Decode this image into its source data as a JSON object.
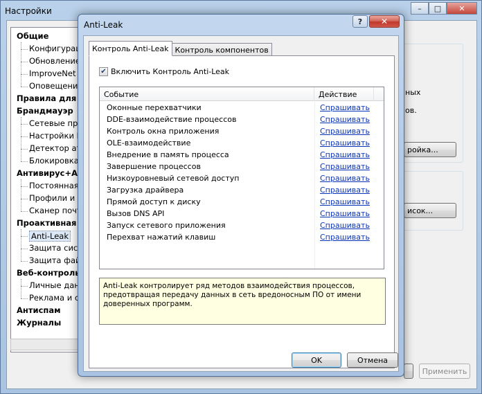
{
  "background_window": {
    "title": "Настройки",
    "controls": {
      "minimize": "–",
      "maximize": "□",
      "close": "✕"
    },
    "tree": [
      {
        "label": "Общие",
        "kind": "cat"
      },
      {
        "label": "Конфигурация",
        "kind": "sub"
      },
      {
        "label": "Обновление",
        "kind": "sub"
      },
      {
        "label": "ImproveNet",
        "kind": "sub"
      },
      {
        "label": "Оповещения",
        "kind": "sub"
      },
      {
        "label": "Правила для пр",
        "kind": "cat"
      },
      {
        "label": "Брандмауэр",
        "kind": "cat"
      },
      {
        "label": "Сетевые пра",
        "kind": "sub"
      },
      {
        "label": "Настройки L",
        "kind": "sub"
      },
      {
        "label": "Детектор ата",
        "kind": "sub"
      },
      {
        "label": "Блокировка",
        "kind": "sub"
      },
      {
        "label": "Антивирус+Ант",
        "kind": "cat"
      },
      {
        "label": "Постоянная",
        "kind": "sub"
      },
      {
        "label": "Профили и р",
        "kind": "sub"
      },
      {
        "label": "Сканер почт",
        "kind": "sub"
      },
      {
        "label": "Проактивная за",
        "kind": "cat"
      },
      {
        "label": "Anti-Leak",
        "kind": "sub",
        "selected": true
      },
      {
        "label": "Защита сист",
        "kind": "sub"
      },
      {
        "label": "Защита фай",
        "kind": "sub"
      },
      {
        "label": "Веб-контроль",
        "kind": "cat"
      },
      {
        "label": "Личные данн",
        "kind": "sub"
      },
      {
        "label": "Реклама и са",
        "kind": "sub"
      },
      {
        "label": "Антиспам",
        "kind": "cat"
      },
      {
        "label": "Журналы",
        "kind": "cat"
      }
    ],
    "right_fragments": {
      "text_1": "ных",
      "text_2": "ов.",
      "button_1": "ройка...",
      "button_2": "исок..."
    },
    "apply_button": "Применить"
  },
  "dialog": {
    "title": "Anti-Leak",
    "help_button": "?",
    "close_button": "✕",
    "tabs": [
      {
        "label": "Контроль Anti-Leak",
        "active": true
      },
      {
        "label": "Контроль компонентов",
        "active": false
      }
    ],
    "enable_checkbox": {
      "label": "Включить Контроль Anti-Leak",
      "checked": true,
      "mark": "✔"
    },
    "list": {
      "columns": {
        "event": "Событие",
        "action": "Действие"
      },
      "rows": [
        {
          "event": "Оконные перехватчики",
          "action": "Спрашивать"
        },
        {
          "event": "DDE-взаимодействие процессов",
          "action": "Спрашивать"
        },
        {
          "event": "Контроль окна приложения",
          "action": "Спрашивать"
        },
        {
          "event": "OLE-взаимодействие",
          "action": "Спрашивать"
        },
        {
          "event": "Внедрение в память процесса",
          "action": "Спрашивать"
        },
        {
          "event": "Завершение процессов",
          "action": "Спрашивать"
        },
        {
          "event": "Низкоуровневый сетевой доступ",
          "action": "Спрашивать"
        },
        {
          "event": "Загрузка драйвера",
          "action": "Спрашивать"
        },
        {
          "event": "Прямой доступ к диску",
          "action": "Спрашивать"
        },
        {
          "event": "Вызов DNS API",
          "action": "Спрашивать"
        },
        {
          "event": "Запуск сетевого приложения",
          "action": "Спрашивать"
        },
        {
          "event": "Перехват нажатий клавиш",
          "action": "Спрашивать"
        }
      ]
    },
    "info_text": "Anti-Leak контролирует ряд методов взаимодействия процессов, предотвращая передачу данных в сеть вредоносным ПО от имени доверенных программ.",
    "ok_button": "OK",
    "cancel_button": "Отмена"
  }
}
